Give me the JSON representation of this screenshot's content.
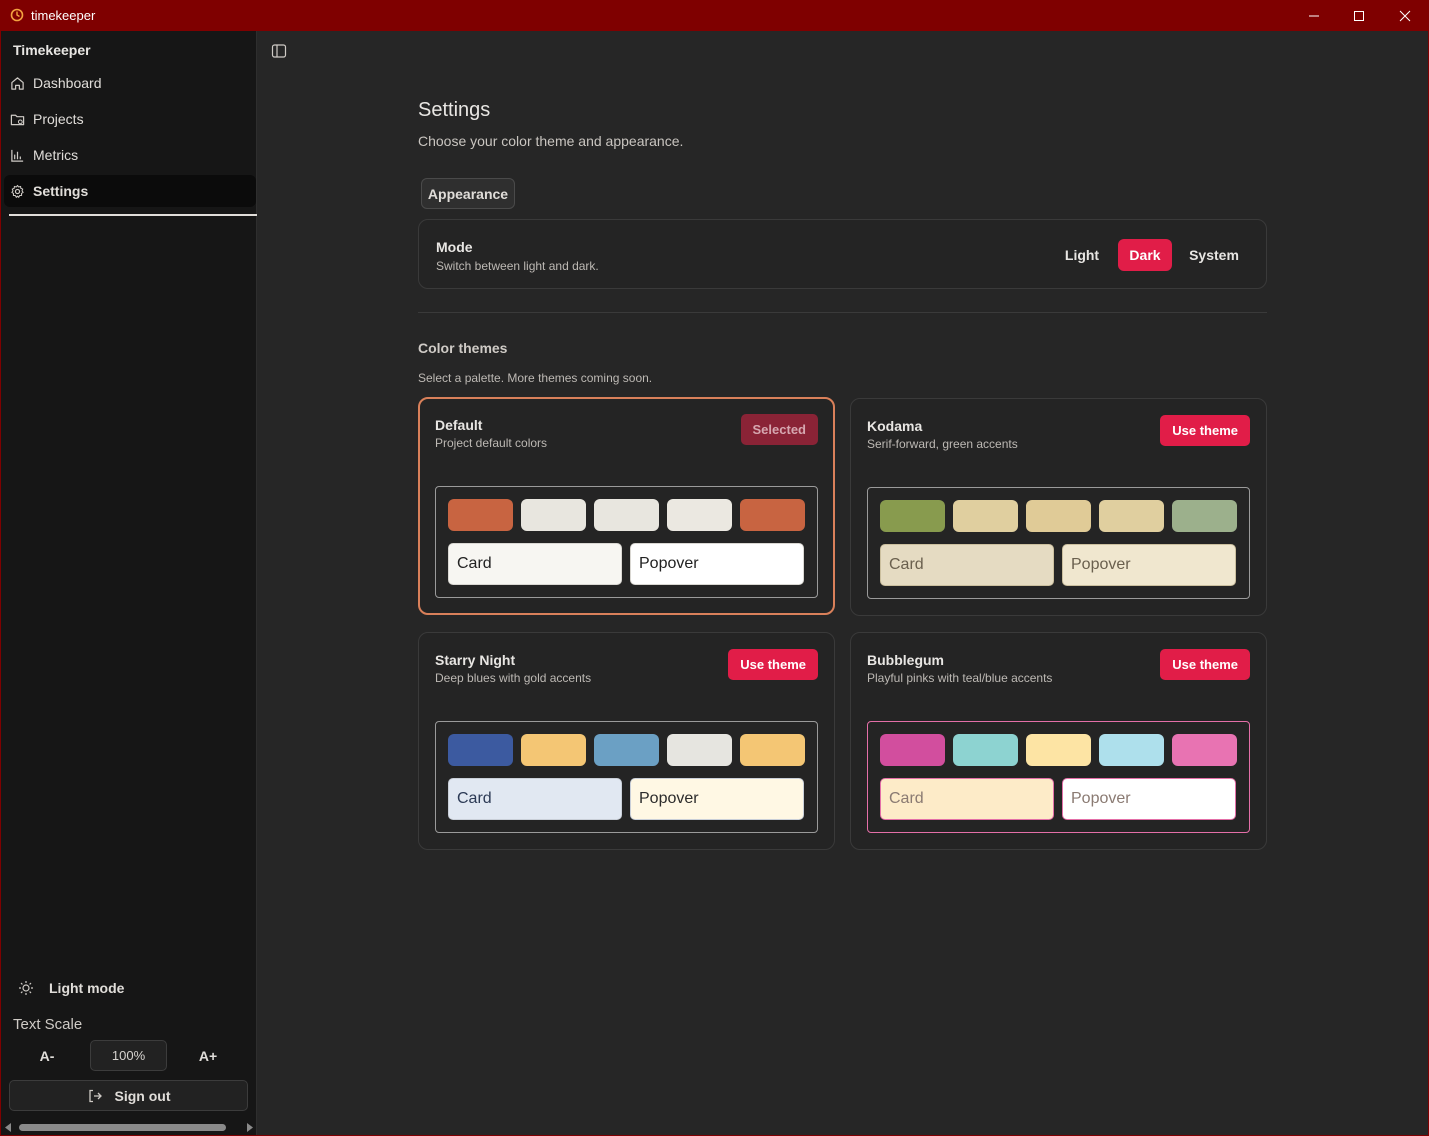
{
  "window": {
    "title": "timekeeper"
  },
  "sidebar": {
    "brand": "Timekeeper",
    "items": [
      {
        "label": "Dashboard",
        "icon": "home-icon"
      },
      {
        "label": "Projects",
        "icon": "folder-icon"
      },
      {
        "label": "Metrics",
        "icon": "bar-chart-icon"
      },
      {
        "label": "Settings",
        "icon": "gear-icon",
        "active": true
      }
    ],
    "light_mode_label": "Light mode",
    "text_scale_label": "Text Scale",
    "scale_minus": "A-",
    "scale_value": "100%",
    "scale_plus": "A+",
    "sign_out": "Sign out"
  },
  "settings": {
    "title": "Settings",
    "subtitle": "Choose your color theme and appearance.",
    "tab": "Appearance",
    "mode": {
      "title": "Mode",
      "subtitle": "Switch between light and dark.",
      "options": [
        "Light",
        "Dark",
        "System"
      ],
      "selected": "Dark"
    },
    "themes_title": "Color themes",
    "themes_subtitle": "Select a palette. More themes coming soon.",
    "themes": [
      {
        "name": "Default",
        "desc": "Project default colors",
        "button": "Selected",
        "selected": true,
        "swatches": [
          "#c86441",
          "#e8e6df",
          "#e8e6df",
          "#ebe8e1",
          "#c86441"
        ],
        "card_label": "Card",
        "popover_label": "Popover",
        "card_bg": "#f7f6f2",
        "card_fg": "#222222",
        "pop_bg": "#ffffff",
        "pop_fg": "#222222",
        "border": "#d9d7d2"
      },
      {
        "name": "Kodama",
        "desc": "Serif-forward, green accents",
        "button": "Use theme",
        "selected": false,
        "swatches": [
          "#889b4e",
          "#e0cf9f",
          "#e0cb97",
          "#e0cf9f",
          "#9cb08c"
        ],
        "card_label": "Card",
        "popover_label": "Popover",
        "card_bg": "#e5dbc2",
        "card_fg": "#6a604e",
        "pop_bg": "#f0e7cf",
        "pop_fg": "#6a604e",
        "border": "#cbbf9e"
      },
      {
        "name": "Starry Night",
        "desc": "Deep blues with gold accents",
        "button": "Use theme",
        "selected": false,
        "swatches": [
          "#3c5aa0",
          "#f4c674",
          "#6ba0c4",
          "#e6e5e0",
          "#f4c674"
        ],
        "card_label": "Card",
        "popover_label": "Popover",
        "card_bg": "#e1e8f2",
        "card_fg": "#2c3a55",
        "pop_bg": "#fff8e4",
        "pop_fg": "#2c2c2c",
        "border": "#c9cfd8"
      },
      {
        "name": "Bubblegum",
        "desc": "Playful pinks with teal/blue accents",
        "button": "Use theme",
        "selected": false,
        "swatches": [
          "#d24e9e",
          "#8dd3d1",
          "#fde4a4",
          "#aee0ec",
          "#e873b2"
        ],
        "card_label": "Card",
        "popover_label": "Popover",
        "card_bg": "#fdebc8",
        "card_fg": "#8a7a72",
        "pop_bg": "#ffffff",
        "pop_fg": "#8a7a72",
        "border": "#e46fa8",
        "preview_border": "#e46fa8"
      }
    ]
  }
}
